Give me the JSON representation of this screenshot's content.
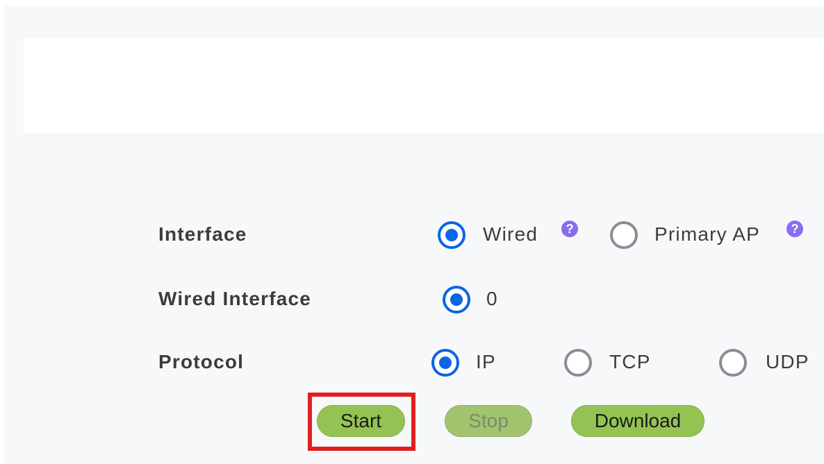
{
  "form": {
    "interface": {
      "label": "Interface",
      "options": [
        {
          "label": "Wired",
          "selected": true,
          "help": "?"
        },
        {
          "label": "Primary AP",
          "selected": false,
          "help": "?"
        }
      ]
    },
    "wired_interface": {
      "label": "Wired Interface",
      "options": [
        {
          "label": "0",
          "selected": true
        }
      ]
    },
    "protocol": {
      "label": "Protocol",
      "options": [
        {
          "label": "IP",
          "selected": true
        },
        {
          "label": "TCP",
          "selected": false
        },
        {
          "label": "UDP",
          "selected": false
        }
      ]
    }
  },
  "actions": {
    "start_label": "Start",
    "stop_label": "Stop",
    "download_label": "Download",
    "stop_disabled": true
  },
  "colors": {
    "radio_selected": "#0a66e4",
    "radio_unselected": "#8c8c94",
    "button_green": "#95c353",
    "highlight_red": "#e02020",
    "help_purple": "#8a6cf0"
  },
  "icons": {
    "help": "question-circle-icon",
    "radio_on": "radio-checked-icon",
    "radio_off": "radio-unchecked-icon"
  }
}
